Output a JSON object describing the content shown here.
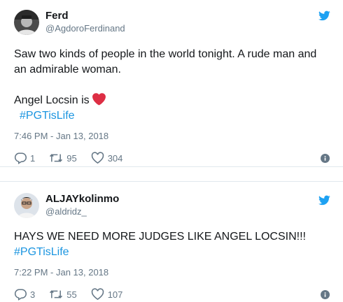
{
  "tweets": [
    {
      "display_name": "Ferd",
      "handle": "@AgdoroFerdinand",
      "text_line1": "Saw two kinds of people in the world tonight. A rude man and an admirable woman.",
      "text_line2": "Angel Locsin is",
      "hashtag": "#PGTisLife",
      "timestamp": "7:46 PM - Jan 13, 2018",
      "replies": "1",
      "retweets": "95",
      "likes": "304"
    },
    {
      "display_name": "ALJAYkolinmo",
      "handle": "@aldridz_",
      "text_line1": "HAYS WE NEED MORE JUDGES LIKE ANGEL LOCSIN!!!",
      "hashtag": "#PGTisLife",
      "timestamp": "7:22 PM - Jan 13, 2018",
      "replies": "3",
      "retweets": "55",
      "likes": "107"
    }
  ],
  "icons": {
    "reply": "reply-icon",
    "retweet": "retweet-icon",
    "like": "heart-outline-icon",
    "info": "info-icon",
    "brand": "twitter-bird-icon",
    "emoji": "red-heart-emoji"
  },
  "colors": {
    "twitter_blue": "#1da1f2",
    "hashtag": "#1b95e0",
    "muted": "#657786",
    "heart_emoji": "#dd2e44"
  }
}
